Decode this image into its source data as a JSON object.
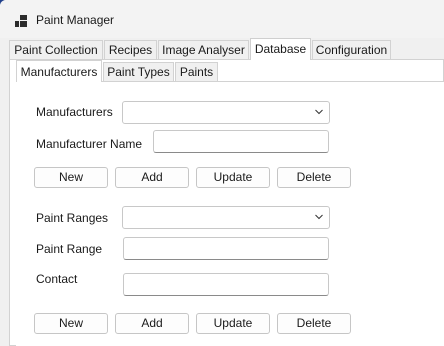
{
  "window": {
    "title": "Paint Manager",
    "icon": "app-windows-icon"
  },
  "tabs": [
    {
      "label": "Paint Collection"
    },
    {
      "label": "Recipes"
    },
    {
      "label": "Image Analyser"
    },
    {
      "label": "Database"
    },
    {
      "label": "Configuration"
    }
  ],
  "active_tab": "Database",
  "subtabs": [
    {
      "label": "Manufacturers"
    },
    {
      "label": "Paint Types"
    },
    {
      "label": "Paints"
    }
  ],
  "active_subtab": "Manufacturers",
  "manufacturers": {
    "select_label": "Manufacturers",
    "select_value": "",
    "name_label": "Manufacturer Name",
    "name_value": "",
    "buttons": {
      "new": "New",
      "add": "Add",
      "update": "Update",
      "delete": "Delete"
    }
  },
  "paint_ranges": {
    "select_label": "Paint Ranges",
    "select_value": "",
    "range_label": "Paint Range",
    "range_value": "",
    "contact_label": "Contact",
    "contact_value": "",
    "buttons": {
      "new": "New",
      "add": "Add",
      "update": "Update",
      "delete": "Delete"
    }
  }
}
